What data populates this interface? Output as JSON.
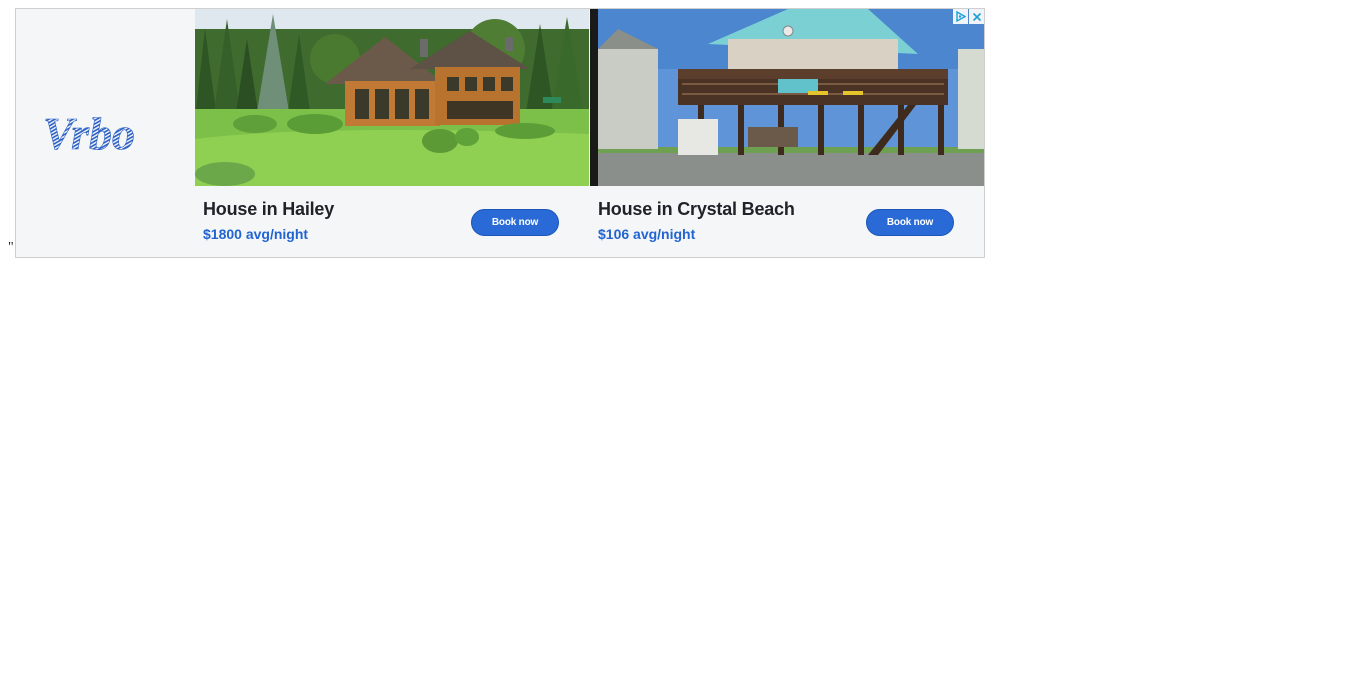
{
  "stray_text": "\"",
  "brand": {
    "logo_text": "Vrbo",
    "logo_color": "#2a5fc4"
  },
  "listings": [
    {
      "title": "House in Hailey",
      "price": "$1800 avg/night",
      "button_label": "Book now",
      "image": "log-cabin-house-on-green-lawn"
    },
    {
      "title": "House in Crystal Beach",
      "price": "$106 avg/night",
      "button_label": "Book now",
      "image": "stilt-beach-house-with-deck"
    }
  ],
  "ad_controls": {
    "adchoices_icon": "adchoices-triangle-icon",
    "close_icon": "close-x-icon"
  },
  "colors": {
    "accent": "#2a6ad6",
    "price_blue": "#2264d1",
    "panel_bg": "#f4f6f8"
  }
}
